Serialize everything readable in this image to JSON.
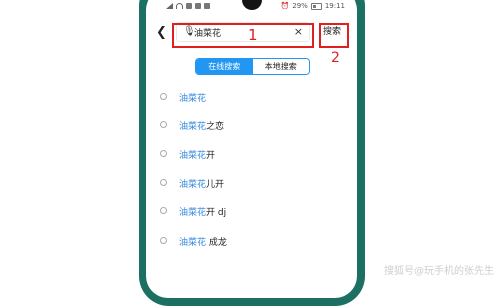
{
  "status_bar": {
    "left_icons": [
      "signal-icon",
      "wifi-icon",
      "app-icon",
      "app-icon",
      "app-icon"
    ],
    "battery": "29%",
    "time": "19:11"
  },
  "search": {
    "query": "油菜花",
    "button_label": "搜索"
  },
  "annotations": {
    "label1": "1",
    "label2": "2"
  },
  "tabs": {
    "online": "在线搜索",
    "local": "本地搜索"
  },
  "suggestions": [
    {
      "highlight": "油菜花",
      "rest": ""
    },
    {
      "highlight": "油菜花",
      "rest": "之恋"
    },
    {
      "highlight": "油菜花",
      "rest": "开"
    },
    {
      "highlight": "油菜花",
      "rest": "儿开"
    },
    {
      "highlight": "油菜花",
      "rest": "开 dj"
    },
    {
      "highlight": "油菜花",
      "rest": " 成龙"
    }
  ],
  "watermark": "搜狐号@玩手机的张先生",
  "colors": {
    "accent": "#2196f3",
    "highlight": "#2f86de",
    "annotation": "#e02020",
    "frame": "#1c6f63"
  }
}
